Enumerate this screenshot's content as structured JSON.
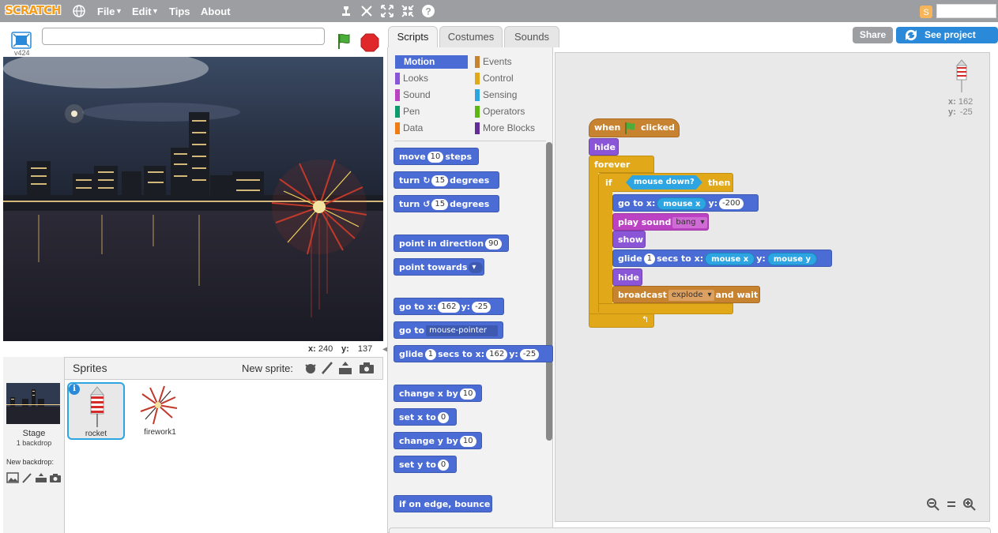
{
  "menu": {
    "logo": "SCRATCH",
    "file": "File",
    "edit": "Edit",
    "tips": "Tips",
    "about": "About"
  },
  "stage_header": {
    "version": "v424"
  },
  "top_buttons": {
    "share": "Share",
    "see_project_page": "See project page"
  },
  "stage_coords": {
    "x_label": "x:",
    "x_value": "240",
    "y_label": "y:",
    "y_value": "137"
  },
  "tabs": {
    "scripts": "Scripts",
    "costumes": "Costumes",
    "sounds": "Sounds"
  },
  "categories": [
    {
      "label": "Motion",
      "color": "#4a6cd4"
    },
    {
      "label": "Looks",
      "color": "#8a55d7"
    },
    {
      "label": "Sound",
      "color": "#bb42c3"
    },
    {
      "label": "Pen",
      "color": "#0e9a6c"
    },
    {
      "label": "Data",
      "color": "#ee7d16"
    },
    {
      "label": "Events",
      "color": "#c88330"
    },
    {
      "label": "Control",
      "color": "#e1a91a"
    },
    {
      "label": "Sensing",
      "color": "#2ca5e2"
    },
    {
      "label": "Operators",
      "color": "#5cb712"
    },
    {
      "label": "More Blocks",
      "color": "#632d99"
    }
  ],
  "palette": {
    "move": "move",
    "move_n": "10",
    "move_steps": "steps",
    "turn": "turn",
    "turn_n": "15",
    "degrees": "degrees",
    "point_dir": "point in direction",
    "point_dir_n": "90",
    "point_towards": "point towards",
    "goto": "go to x:",
    "goto_x": "162",
    "y": "y:",
    "goto_y": "-25",
    "goto_label": "go to",
    "goto_target": "mouse-pointer",
    "glide": "glide",
    "glide_n": "1",
    "glide_secs": "secs to x:",
    "glide_x": "162",
    "glide_y": "-25",
    "change_x": "change x by",
    "change_x_n": "10",
    "set_x": "set x to",
    "set_x_n": "0",
    "change_y": "change y by",
    "change_y_n": "10",
    "set_y": "set y to",
    "set_y_n": "0",
    "bounce": "if on edge, bounce"
  },
  "script": {
    "when": "when",
    "clicked": "clicked",
    "hide1": "hide",
    "forever": "forever",
    "if": "if",
    "mouse_down": "mouse down?",
    "then": "then",
    "goto": "go to x:",
    "mouse_x": "mouse x",
    "y": "y:",
    "goto_y": "-200",
    "play_sound": "play sound",
    "sound_name": "bang",
    "show": "show",
    "glide": "glide",
    "glide_n": "1",
    "glide_secs": "secs to x:",
    "glide_mouse_x": "mouse x",
    "glide_y_label": "y:",
    "glide_mouse_y": "mouse y",
    "hide2": "hide",
    "broadcast": "broadcast",
    "message": "explode",
    "and_wait": "and wait"
  },
  "sprite_info": {
    "x_label": "x:",
    "x": "162",
    "y_label": "y:",
    "y": "-25"
  },
  "sprites_panel": {
    "title": "Sprites",
    "new_sprite": "New sprite:",
    "stage_label": "Stage",
    "backdrops": "1 backdrop",
    "new_backdrop": "New backdrop:",
    "sprites": [
      {
        "name": "rocket"
      },
      {
        "name": "firework1"
      }
    ]
  }
}
